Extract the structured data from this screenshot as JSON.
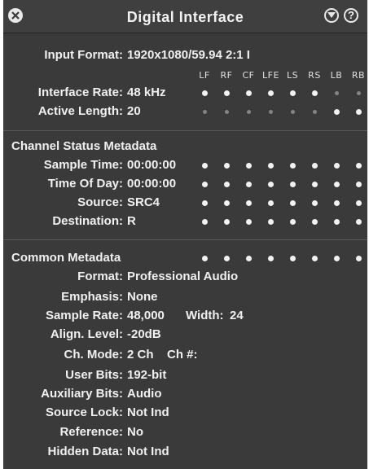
{
  "window": {
    "title": "Digital Interface"
  },
  "rows": {
    "input_format": {
      "label": "Input Format:",
      "value": "1920x1080/59.94 2:1 I"
    },
    "interface_rate": {
      "label": "Interface Rate:",
      "value": "48 kHz"
    },
    "active_length": {
      "label": "Active Length:",
      "value": "20"
    }
  },
  "channels": [
    "LF",
    "RF",
    "CF",
    "LFE",
    "LS",
    "RS",
    "LB",
    "RB"
  ],
  "channel_status": {
    "header": "Channel Status Metadata",
    "sample_time": {
      "label": "Sample Time:",
      "value": "00:00:00"
    },
    "time_of_day": {
      "label": "Time Of Day:",
      "value": "00:00:00"
    },
    "source": {
      "label": "Source:",
      "value": "SRC4"
    },
    "destination": {
      "label": "Destination:",
      "value": "R"
    }
  },
  "common": {
    "header": "Common Metadata",
    "format": {
      "label": "Format:",
      "value": "Professional Audio"
    },
    "emphasis": {
      "label": "Emphasis:",
      "value": "None"
    },
    "sample_rate": {
      "label": "Sample Rate:",
      "value": "48,000",
      "width_label": "Width:",
      "width_value": "24"
    },
    "align_level": {
      "label": "Align. Level:",
      "value": "-20dB"
    },
    "ch_mode": {
      "label": "Ch. Mode:",
      "value": "2 Ch",
      "chnum_label": "Ch #:"
    },
    "user_bits": {
      "label": "User Bits:",
      "value": "192-bit"
    },
    "aux_bits": {
      "label": "Auxiliary Bits:",
      "value": "Audio"
    },
    "source_lock": {
      "label": "Source Lock:",
      "value": "Not Ind"
    },
    "reference": {
      "label": "Reference:",
      "value": "No"
    },
    "hidden_data": {
      "label": "Hidden Data:",
      "value": "Not Ind"
    }
  },
  "indicators": {
    "interface_rate": [
      "on",
      "on",
      "on",
      "on",
      "on",
      "on",
      "off",
      "off"
    ],
    "active_length": [
      "off",
      "off",
      "off",
      "off",
      "off",
      "off",
      "on",
      "on"
    ],
    "sample_time": [
      "on",
      "on",
      "on",
      "on",
      "on",
      "on",
      "on",
      "on"
    ],
    "time_of_day": [
      "on",
      "on",
      "on",
      "on",
      "on",
      "on",
      "on",
      "on"
    ],
    "source": [
      "on",
      "on",
      "on",
      "on",
      "on",
      "on",
      "on",
      "on"
    ],
    "destination": [
      "on",
      "on",
      "on",
      "on",
      "on",
      "on",
      "on",
      "on"
    ],
    "common_metadata": [
      "on",
      "on",
      "on",
      "on",
      "on",
      "on",
      "on",
      "on"
    ]
  },
  "colors": {
    "panel_bg": "#3a3a3a",
    "text": "#f0f0f0",
    "indicator_on": "#f2f2f2",
    "indicator_off": "#858585"
  },
  "icons": {
    "close": "close-icon",
    "menu": "chevron-down-circle-icon",
    "help": "help-icon"
  }
}
